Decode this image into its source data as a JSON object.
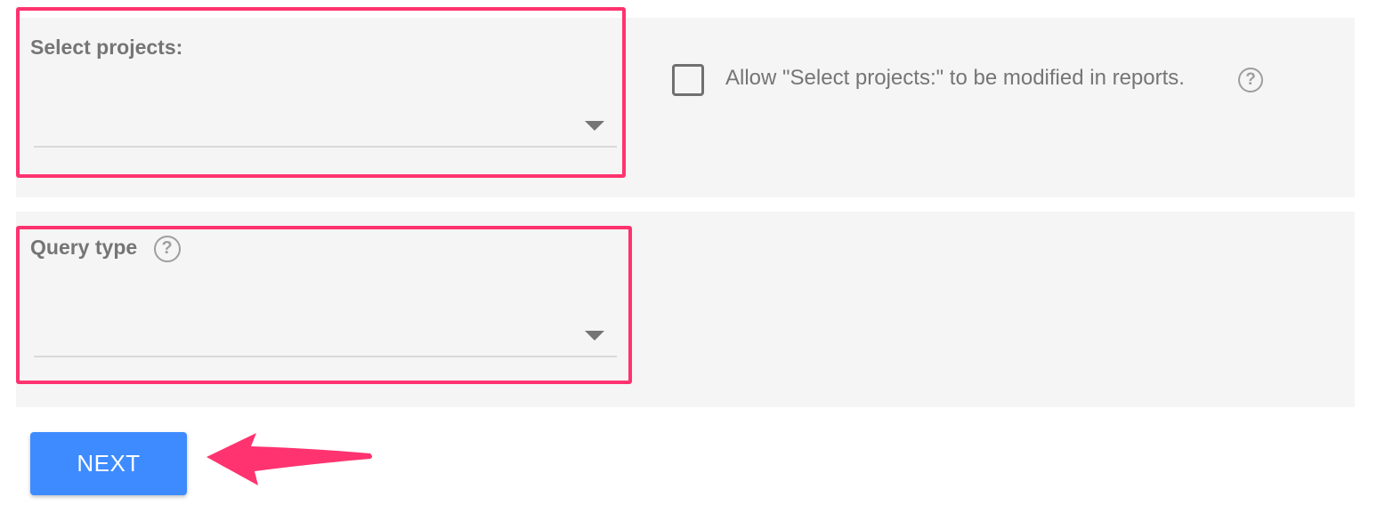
{
  "projects_field": {
    "label": "Select projects:",
    "value": ""
  },
  "allow_modify": {
    "label": "Allow \"Select projects:\" to be modified in reports.",
    "checked": false,
    "help_icon": "help-circle-icon"
  },
  "query_type_field": {
    "label": "Query type",
    "value": "",
    "help_icon": "help-circle-icon"
  },
  "next_button": {
    "label": "NEXT"
  },
  "colors": {
    "panel_bg": "#f5f5f5",
    "highlight": "#ff336f",
    "primary_button": "#3d8bff",
    "text_muted": "#757575"
  }
}
